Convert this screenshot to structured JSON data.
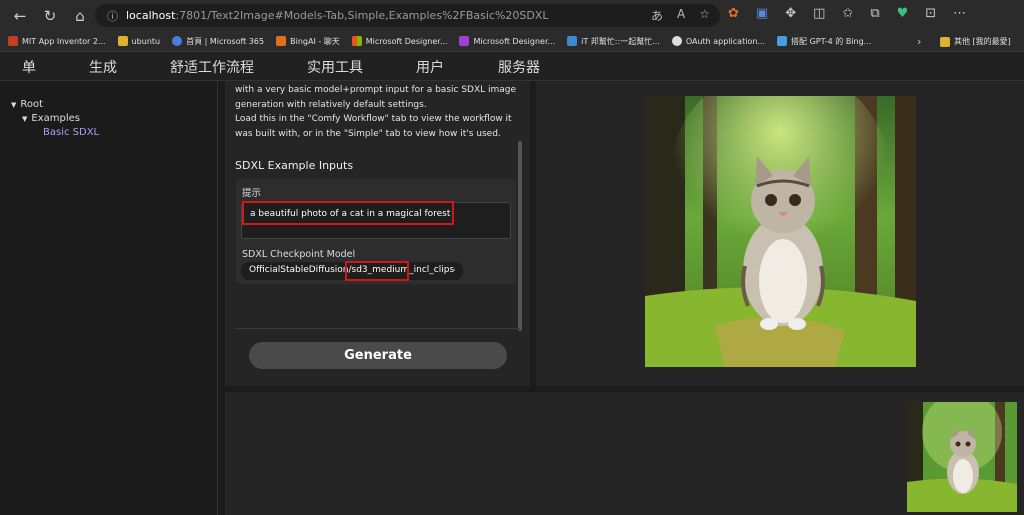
{
  "browser": {
    "url_host": "localhost",
    "url_path": ":7801/Text2Image#Models-Tab,Simple,Examples%2FBasic%20SDXL",
    "bookmarks": [
      {
        "label": "MIT App Inventor 2...",
        "color": "#c04020"
      },
      {
        "label": "ubuntu",
        "color": "#e0b030"
      },
      {
        "label": "首頁 | Microsoft 365",
        "color": "#4a7fe0"
      },
      {
        "label": "BingAI - 聊天",
        "color": "#e07020"
      },
      {
        "label": "Microsoft Designer...",
        "color": "#e04040"
      },
      {
        "label": "Microsoft Designer...",
        "color": "#a040d0"
      },
      {
        "label": "iT 邦幫忙::一起幫忙...",
        "color": "#3a8ad0"
      },
      {
        "label": "OAuth application...",
        "color": "#dddddd"
      },
      {
        "label": "搭配 GPT-4 的 Bing...",
        "color": "#40a0e0"
      }
    ],
    "bookmark_folder": "其他 [我的最愛]"
  },
  "nav": {
    "tabs": [
      "单",
      "生成",
      "舒适工作流程",
      "实用工具",
      "用户",
      "服务器"
    ]
  },
  "tree": {
    "root": "Root",
    "examples": "Examples",
    "basic_sdxl": "Basic SDXL"
  },
  "description": {
    "line1": "with a very basic model+prompt input for a basic SDXL image",
    "line2": "generation with relatively default settings.",
    "line3": "Load this in the \"Comfy Workflow\" tab to view the workflow it",
    "line4": "was built with, or in the \"Simple\" tab to view how it's used."
  },
  "inputs": {
    "title": "SDXL Example Inputs",
    "prompt_label": "提示",
    "prompt_value": "a beautiful photo of a cat in a magical forest",
    "model_label": "SDXL Checkpoint Model",
    "model_value": "OfficialStableDiffusion/sd3_medium_incl_clips"
  },
  "generate_label": "Generate",
  "colors": {
    "accent_highlight": "#d01818",
    "link": "#a8a0f0"
  }
}
